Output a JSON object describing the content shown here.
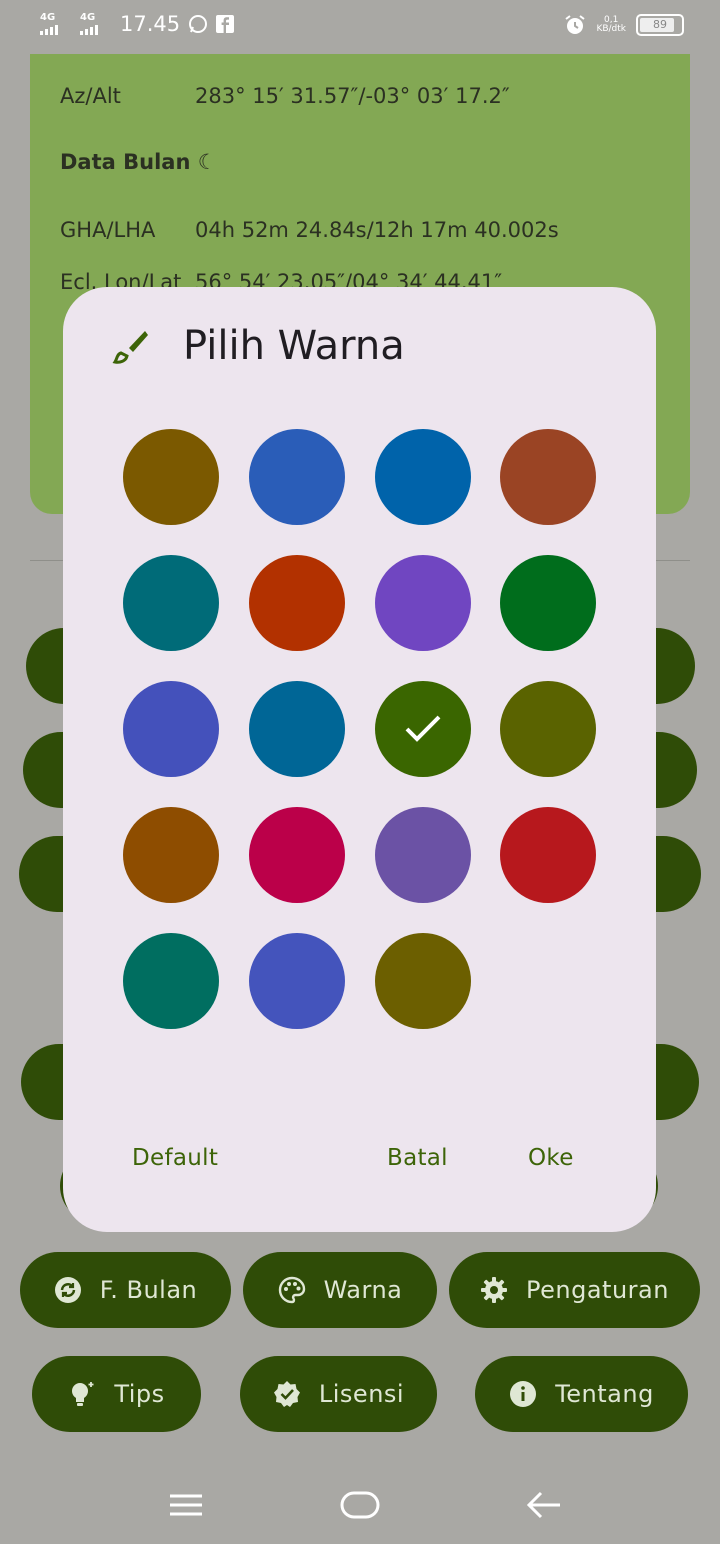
{
  "status": {
    "network1": "4G",
    "network2": "4G",
    "time": "17.45",
    "speed_value": "0,1",
    "speed_unit": "KB/dtk",
    "battery": "89"
  },
  "background": {
    "rows": [
      {
        "key": "Az/Alt",
        "value": "283° 15′ 31.57″/-03° 03′ 17.2″"
      },
      {
        "key": "GHA/LHA",
        "value": "04h 52m 24.84s/12h 17m 40.002s"
      },
      {
        "key": "Ecl. Lon/Lat",
        "value": "56° 54′ 23.05″/04° 34′ 44.41″"
      }
    ],
    "section_title": "Data Bulan ☾",
    "buttons_row1": [
      {
        "label": "F. Bulan",
        "icon": "refresh-icon"
      },
      {
        "label": "Warna",
        "icon": "palette-icon"
      },
      {
        "label": "Pengaturan",
        "icon": "gear-icon"
      }
    ],
    "buttons_row2": [
      {
        "label": "Tips",
        "icon": "lightbulb-icon"
      },
      {
        "label": "Lisensi",
        "icon": "verified-badge-icon"
      },
      {
        "label": "Tentang",
        "icon": "info-icon"
      }
    ]
  },
  "dialog": {
    "title": "Pilih Warna",
    "icon": "paintbrush-icon",
    "selected_index": 10,
    "colors": [
      "#7b5900",
      "#2a5db8",
      "#0063aa",
      "#9a4424",
      "#006b78",
      "#b23100",
      "#7046c1",
      "#006d1c",
      "#4451bb",
      "#006696",
      "#3a6600",
      "#5a6300",
      "#8e4d00",
      "#bb0049",
      "#6b52a5",
      "#b7181d",
      "#006e60",
      "#4454bc",
      "#6c5f00"
    ],
    "buttons": {
      "default": "Default",
      "cancel": "Batal",
      "ok": "Oke"
    }
  },
  "colors": {
    "accent_dark": "#2f4c07",
    "card_green": "#83a854",
    "dialog_bg": "#ede5ee",
    "action_text": "#3d6408"
  }
}
